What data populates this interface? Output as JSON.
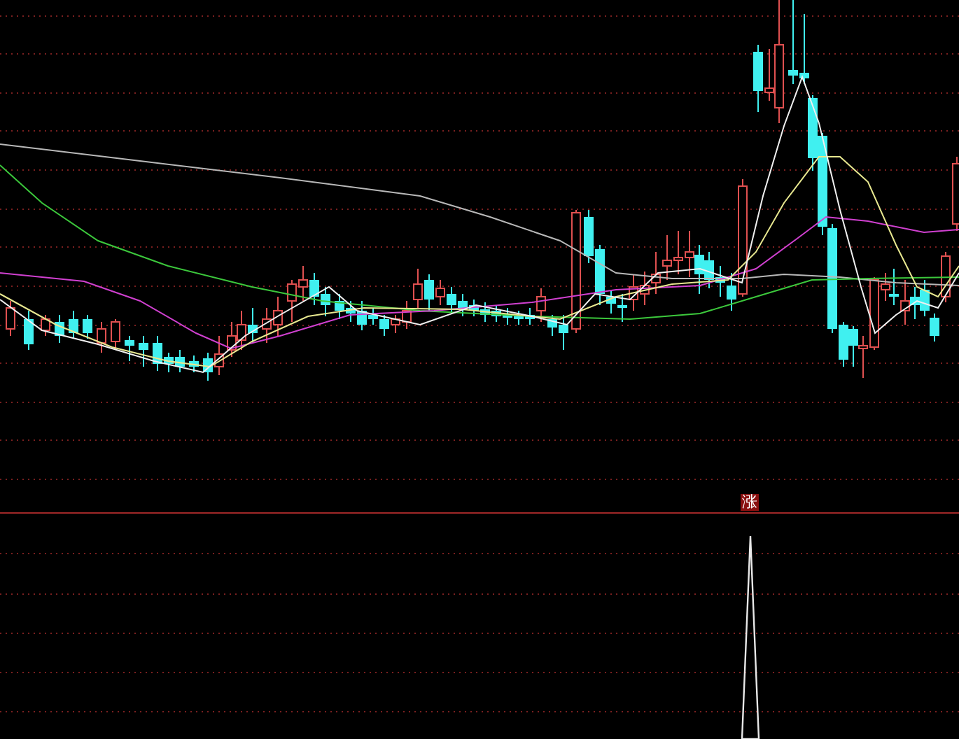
{
  "signal_label": {
    "text": "涨"
  }
}
